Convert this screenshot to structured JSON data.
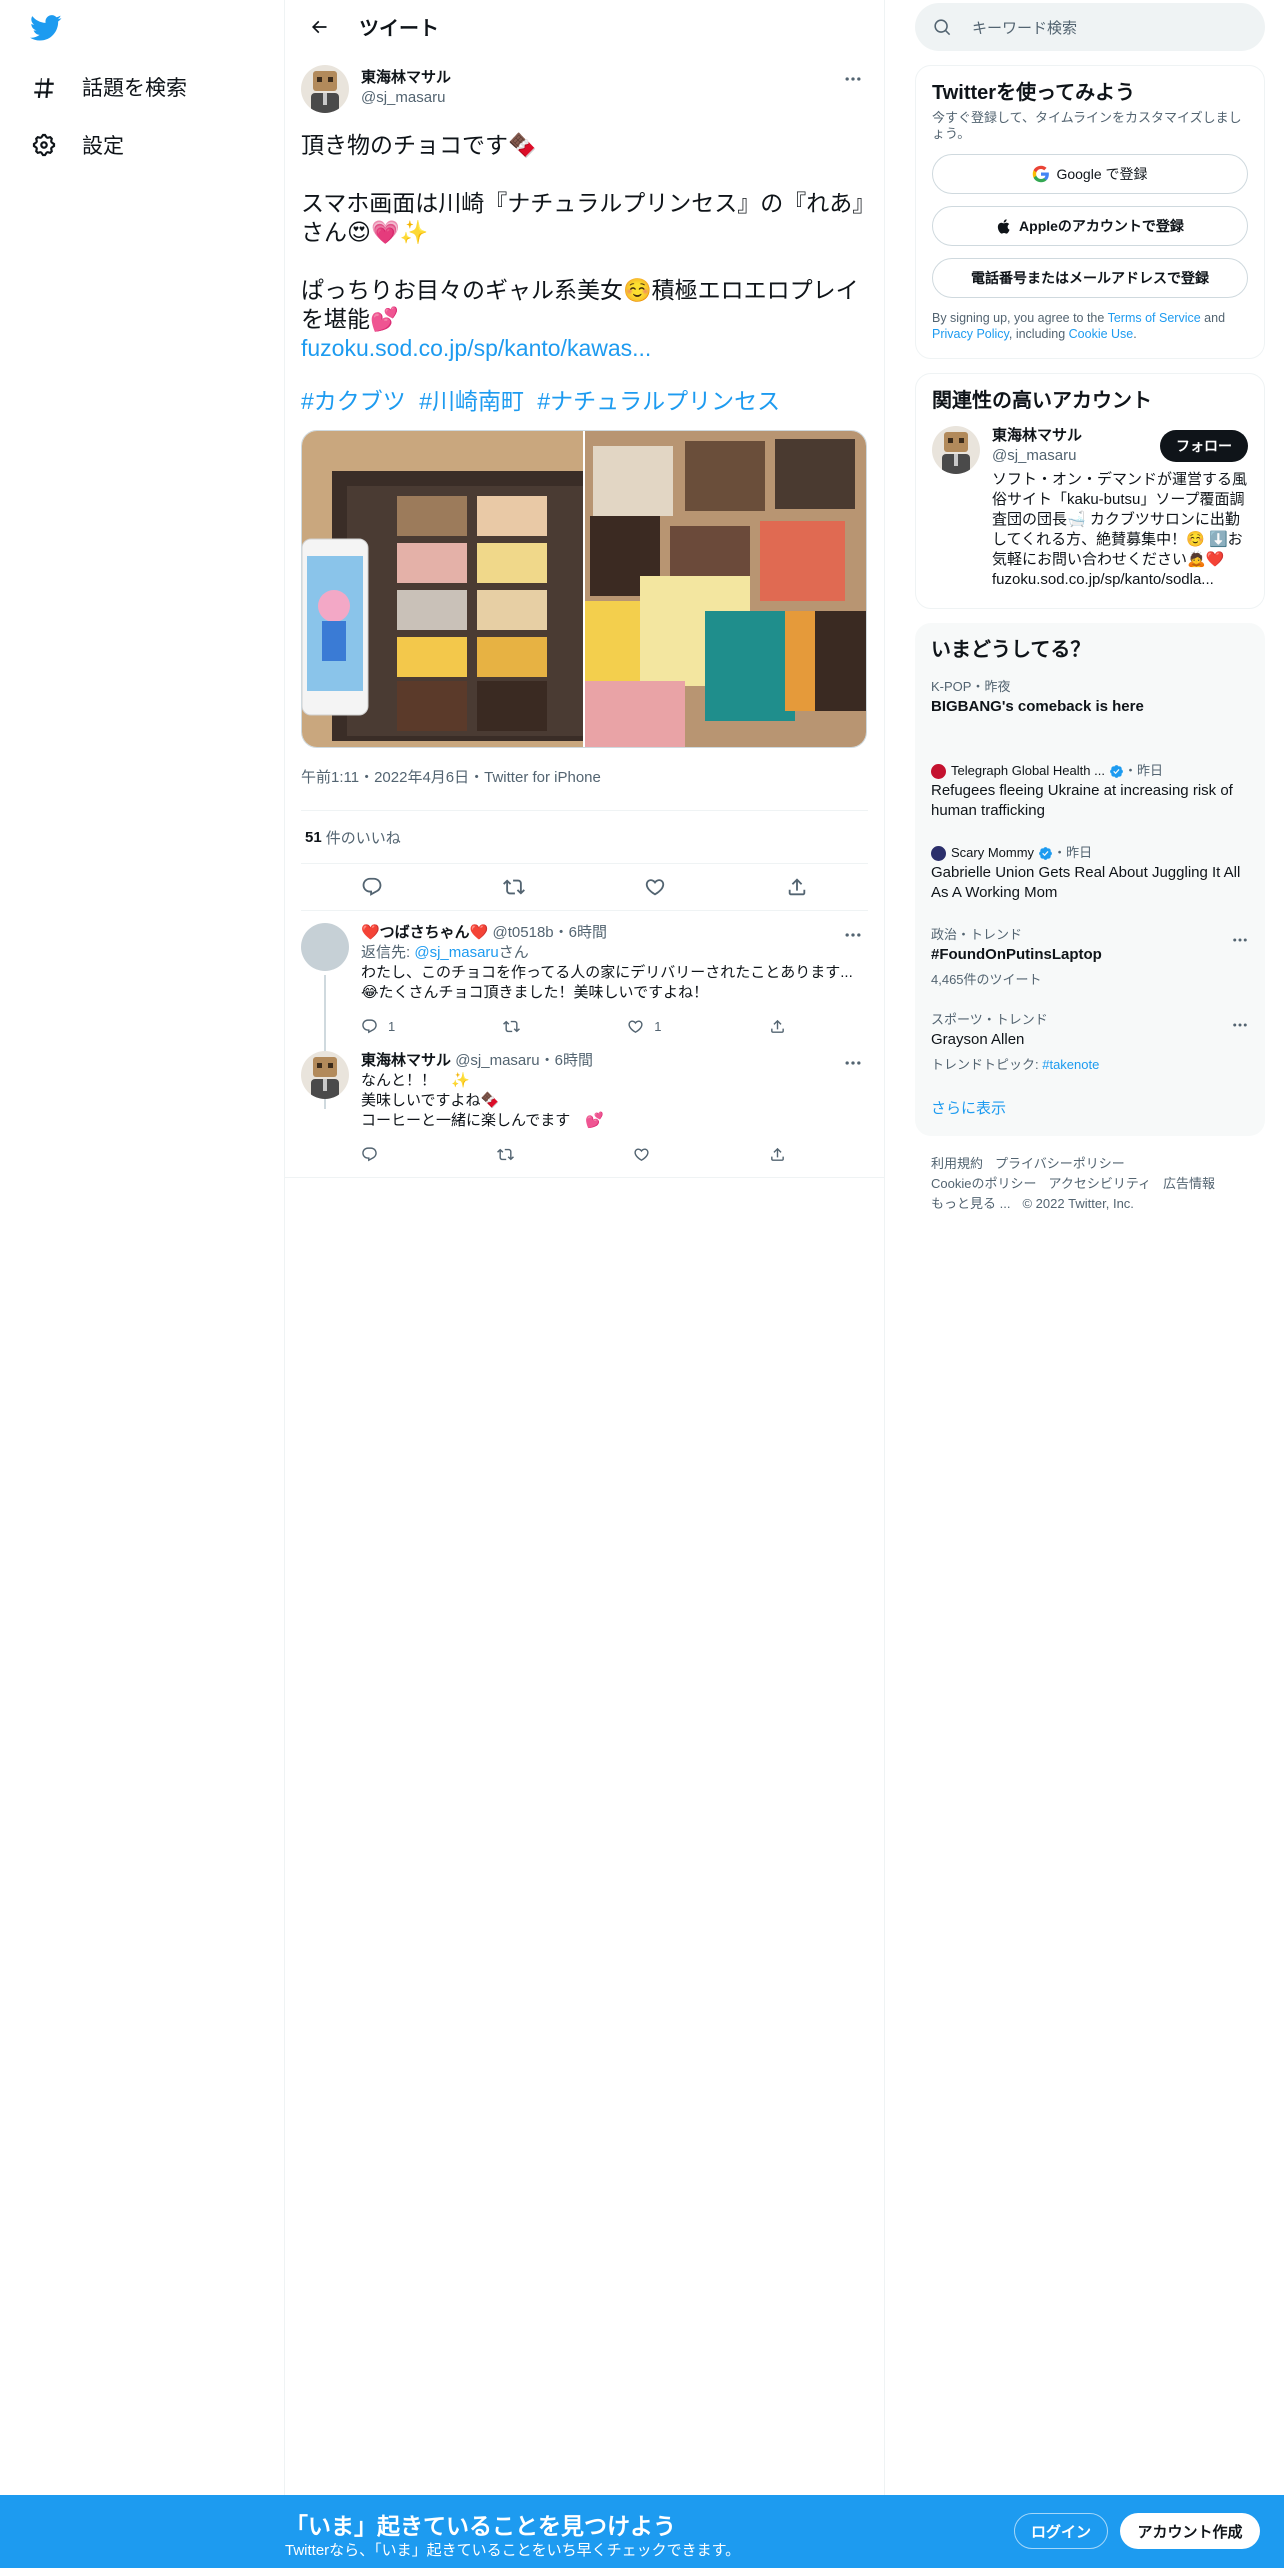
{
  "nav": {
    "explore_label": "話題を検索",
    "settings_label": "設定"
  },
  "header": {
    "title": "ツイート"
  },
  "tweet": {
    "name": "東海林マサル",
    "handle": "@sj_masaru",
    "line1": "頂き物のチョコです🍫",
    "line2": "スマホ画面は川崎『ナチュラルプリンセス』の『れあ』さん😍💗✨",
    "line3": "ぱっちりお目々のギャル系美女☺️積極エロエロプレイを堪能💕",
    "link": "fuzoku.sod.co.jp/sp/kanto/kawas...",
    "hashtags": [
      "#カクブツ",
      "#川崎南町",
      "#ナチュラルプリンセス"
    ],
    "meta": "午前1:11・2022年4月6日・Twitter for iPhone",
    "likes_count": "51",
    "likes_label": "件のいいね"
  },
  "replies": [
    {
      "name": "❤️つばさちゃん❤️",
      "handle": "@t0518b",
      "time": "・6時間",
      "replying_prefix": "返信先: ",
      "replying_to": "@sj_masaru",
      "replying_suffix": "さん",
      "text": "わたし、このチョコを作ってる人の家にデリバリーされたことあります...\n😂たくさんチョコ頂きました！美味しいですよね！",
      "reply_count": "1",
      "like_count": "1"
    },
    {
      "name": "東海林マサル",
      "handle": "@sj_masaru",
      "time": "・6時間",
      "text": "なんと！！　✨\n美味しいですよね🍫\nコーヒーと一緒に楽しんでます　💕",
      "reply_count": "",
      "like_count": ""
    }
  ],
  "search": {
    "placeholder": "キーワード検索"
  },
  "signup": {
    "title": "Twitterを使ってみよう",
    "sub": "今すぐ登録して、タイムラインをカスタマイズしましょう。",
    "google": "Google で登録",
    "apple": "Appleのアカウントで登録",
    "phone": "電話番号またはメールアドレスで登録",
    "legal_1": "By signing up, you agree to the ",
    "terms": "Terms of Service",
    "legal_2": " and ",
    "privacy": "Privacy Policy",
    "legal_3": ", including ",
    "cookie": "Cookie Use",
    "legal_4": "."
  },
  "related": {
    "title": "関連性の高いアカウント",
    "name": "東海林マサル",
    "handle": "@sj_masaru",
    "follow": "フォロー",
    "bio": "ソフト・オン・デマンドが運営する風俗サイト「kaku-butsu」ソープ覆面調査団の団長🛁 カクブツサロンに出勤してくれる方、絶賛募集中！☺️ ⬇️お気軽にお問い合わせください🙇❤️",
    "link": "fuzoku.sod.co.jp/sp/kanto/sodla..."
  },
  "trends": {
    "title": "いまどうしてる？",
    "items": [
      {
        "meta": "K-POP・昨夜",
        "name": "BIGBANG's comeback is here",
        "count": ""
      },
      {
        "meta": "Telegraph Global Health ...",
        "meta2": "・昨日",
        "name": "Refugees fleeing Ukraine at increasing risk of human trafficking",
        "count": ""
      },
      {
        "meta": "Scary Mommy",
        "meta2": "・昨日",
        "name": "Gabrielle Union Gets Real About Juggling It All As A Working Mom",
        "count": ""
      },
      {
        "meta": "政治・トレンド",
        "name": "#FoundOnPutinsLaptop",
        "count": "4,465件のツイート"
      },
      {
        "meta": "スポーツ・トレンド",
        "name": "Grayson Allen",
        "count_prefix": "トレンドトピック: ",
        "count_link": "#takenote"
      }
    ],
    "show_more": "さらに表示"
  },
  "footer": {
    "links": [
      "利用規約",
      "プライバシーポリシー",
      "Cookieのポリシー",
      "アクセシビリティ",
      "広告情報",
      "もっと見る ..."
    ],
    "copyright": "© 2022 Twitter, Inc."
  },
  "bottom": {
    "title": "「いま」起きていることを見つけよう",
    "sub": "Twitterなら、「いま」起きていることをいち早くチェックできます。",
    "login": "ログイン",
    "signup": "アカウント作成"
  },
  "colors": {
    "accent": "#1d9bf0",
    "text": "#0f1419",
    "secondary": "#536471"
  }
}
